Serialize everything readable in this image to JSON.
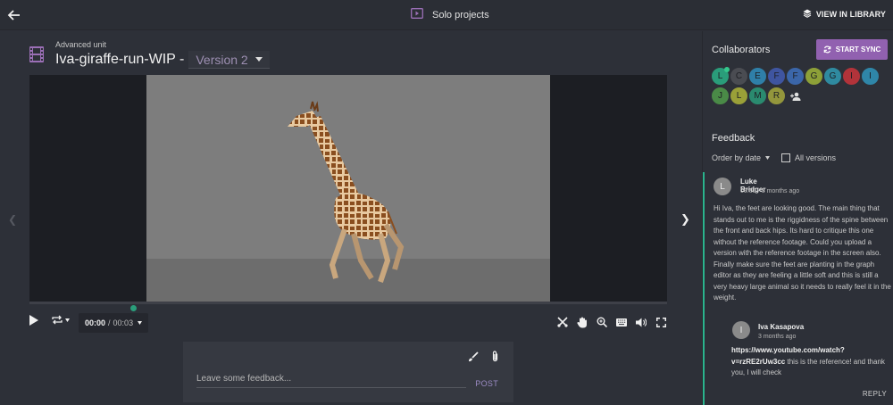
{
  "topbar": {
    "title": "Solo projects",
    "view_library_label": "VIEW IN LIBRARY"
  },
  "header": {
    "unit_label": "Advanced unit",
    "title": "Iva-giraffe-run-WIP -",
    "version": "Version 2"
  },
  "player": {
    "progress": 0.0,
    "current_time": "00:00",
    "separator": "/",
    "duration": "00:03"
  },
  "feedback_input": {
    "placeholder": "Leave some feedback...",
    "post_label": "POST"
  },
  "sidebar": {
    "collaborators_title": "Collaborators",
    "sync_label": "START SYNC",
    "avatars": [
      {
        "letter": "L",
        "color": "#2a9d7a",
        "online": true
      },
      {
        "letter": "C",
        "color": "#4a4c52",
        "online": false
      },
      {
        "letter": "E",
        "color": "#2f7fa8",
        "online": false
      },
      {
        "letter": "F",
        "color": "#3f55a0",
        "online": false
      },
      {
        "letter": "F",
        "color": "#3b66a9",
        "online": false
      },
      {
        "letter": "G",
        "color": "#8da038",
        "online": false
      },
      {
        "letter": "G",
        "color": "#2f8aa0",
        "online": false
      },
      {
        "letter": "I",
        "color": "#b2333a",
        "online": false
      },
      {
        "letter": "I",
        "color": "#2f86a8",
        "online": false
      },
      {
        "letter": "J",
        "color": "#4a8a47",
        "online": false
      },
      {
        "letter": "L",
        "color": "#9aa038",
        "online": false
      },
      {
        "letter": "M",
        "color": "#2a8a6f",
        "online": false
      },
      {
        "letter": "R",
        "color": "#93963c",
        "online": false
      }
    ],
    "feedback_title": "Feedback",
    "order_label": "Order by date",
    "all_versions_label": "All versions",
    "comments": [
      {
        "initial": "L",
        "author": "Luke Bridger",
        "meta": "00:00 - 3 months ago",
        "body": "Hi Iva, the feet are looking good. The main thing that stands out to me is the riggidness of the spine between the front and back hips. Its hard to critique this one without the reference footage. Could you upload a version with the reference footage in the screen also. Finally make sure the feet are planting in the graph editor as they are feeling a little soft and this is still a very heavy large animal so it needs to really feel it in the weight."
      },
      {
        "initial": "I",
        "author": "Iva Kasapova",
        "meta": "3 months ago",
        "link": "https://www.youtube.com/watch?v=rzRE2rUw3cc",
        "body": " this is the reference! and thank you, I will check"
      }
    ],
    "reply_label": "REPLY"
  }
}
